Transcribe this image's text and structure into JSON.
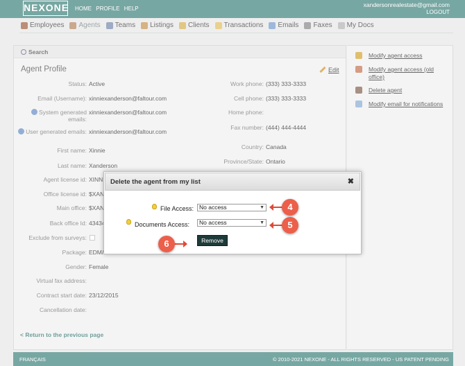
{
  "header": {
    "logo": "NEXONE",
    "nav": [
      "HOME",
      "PROFILE",
      "HELP"
    ],
    "user_email": "xandersonrealestate@gmail.com",
    "logout": "LOGOUT"
  },
  "mainnav": [
    {
      "label": "Employees",
      "icon": "employees-icon",
      "color": "#a5694a"
    },
    {
      "label": "Agents",
      "icon": "agents-icon",
      "color": "#b98d6a"
    },
    {
      "label": "Teams",
      "icon": "teams-icon",
      "color": "#7c8fb0"
    },
    {
      "label": "Listings",
      "icon": "listings-icon",
      "color": "#c79a5b"
    },
    {
      "label": "Clients",
      "icon": "clients-icon",
      "color": "#d7b45a"
    },
    {
      "label": "Transactions",
      "icon": "transactions-icon",
      "color": "#e3c069"
    },
    {
      "label": "Emails",
      "icon": "emails-icon",
      "color": "#7e9fcf"
    },
    {
      "label": "Faxes",
      "icon": "faxes-icon",
      "color": "#8f8f8f"
    },
    {
      "label": "My Docs",
      "icon": "mydocs-icon",
      "color": "#b7b7b7"
    }
  ],
  "search": {
    "label": "Search"
  },
  "profile": {
    "title": "Agent Profile",
    "edit": "Edit",
    "status_label": "Status:",
    "status": "Active",
    "email_label": "Email (Username):",
    "email": "xinniexanderson@faltour.com",
    "sys_email_label": "System generated emails:",
    "sys_email": "xinniexanderson@faltour.com",
    "user_email_label": "User generated emails:",
    "user_email": "xinniexanderson@faltour.com",
    "first_name_label": "First name:",
    "first_name": "Xinnie",
    "last_name_label": "Last name:",
    "last_name": "Xanderson",
    "license_label": "Agent license id:",
    "license": "XINNI",
    "office_license_label": "Office license id:",
    "office_license": "$XAN",
    "main_office_label": "Main office:",
    "main_office": "$XAN",
    "back_office_label": "Back office Id:",
    "back_office": "43434",
    "surveys_label": "Exclude from surveys:",
    "package_label": "Package:",
    "package": "EDM/",
    "gender_label": "Gender:",
    "gender": "Female",
    "virtual_fax_label": "Virtual fax address:",
    "contract_label": "Contract start date:",
    "contract": "23/12/2015",
    "cancellation_label": "Cancellation date:",
    "work_phone_label": "Work phone:",
    "work_phone": "(333) 333-3333",
    "cell_phone_label": "Cell phone:",
    "cell_phone": "(333) 333-3333",
    "home_phone_label": "Home phone:",
    "fax_label": "Fax number:",
    "fax": "(444) 444-4444",
    "country_label": "Country:",
    "country": "Canada",
    "province_label": "Province/State:",
    "province": "Ontario",
    "return": "< Return to the previous page"
  },
  "sidebar": [
    {
      "label": "Modify agent access",
      "icon": "lock-icon",
      "color": "#d6a93c"
    },
    {
      "label": "Modify agent access (old office)",
      "icon": "lock-edit-icon",
      "color": "#c97a5a"
    },
    {
      "label": "Delete agent",
      "icon": "delete-agent-icon",
      "color": "#8a6a5a"
    },
    {
      "label": "Modify email for notifications",
      "icon": "envelope-icon",
      "color": "#8fb0d6"
    }
  ],
  "modal": {
    "title": "Delete the agent from my list",
    "close": "✖",
    "file_access_label": "File Access:",
    "file_access_value": "No access",
    "doc_access_label": "Documents Access:",
    "doc_access_value": "No access",
    "remove": "Remove"
  },
  "steps": [
    "4",
    "5",
    "6"
  ],
  "footer": {
    "lang": "FRANÇAIS",
    "copyright": "© 2010-2021 NEXONE - ALL RIGHTS RESERVED - US PATENT PENDING"
  }
}
